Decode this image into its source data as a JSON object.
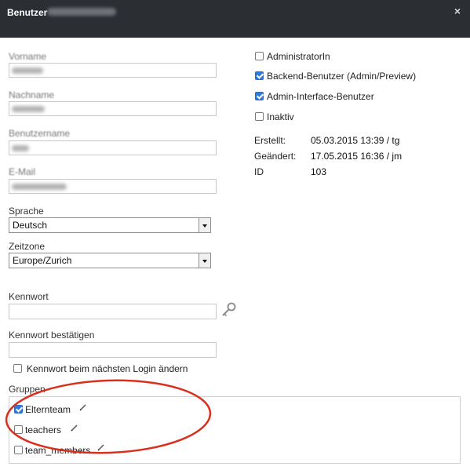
{
  "dialog": {
    "title": "Benutzer",
    "close_glyph": "×"
  },
  "form": {
    "vorname_label": "Vorname",
    "nachname_label": "Nachname",
    "benutzername_label": "Benutzername",
    "email_label": "E-Mail",
    "sprache_label": "Sprache",
    "sprache_value": "Deutsch",
    "zeitzone_label": "Zeitzone",
    "zeitzone_value": "Europe/Zurich",
    "kennwort_label": "Kennwort",
    "kennwort_confirm_label": "Kennwort bestätigen",
    "change_next_login_label": "Kennwort beim nächsten Login ändern",
    "change_next_login_checked": false
  },
  "roles": [
    {
      "label": "AdministratorIn",
      "checked": false
    },
    {
      "label": "Backend-Benutzer (Admin/Preview)",
      "checked": true
    },
    {
      "label": "Admin-Interface-Benutzer",
      "checked": true
    },
    {
      "label": "Inaktiv",
      "checked": false
    }
  ],
  "meta": {
    "created_label": "Erstellt:",
    "created_value": "05.03.2015 13:39 / tg",
    "changed_label": "Geändert:",
    "changed_value": "17.05.2015 16:36 / jm",
    "id_label": "ID",
    "id_value": "103"
  },
  "groups": {
    "label": "Gruppen",
    "items": [
      {
        "label": "Elternteam",
        "checked": true
      },
      {
        "label": "teachers",
        "checked": false
      },
      {
        "label": "team_members",
        "checked": false
      }
    ]
  },
  "icons": {
    "close": "close-icon",
    "key": "key-icon",
    "edit": "pencil-icon"
  },
  "colors": {
    "titlebar": "#2b2e33",
    "checkbox_checked": "#2c7ce0",
    "annotation_circle": "#d9301e"
  }
}
